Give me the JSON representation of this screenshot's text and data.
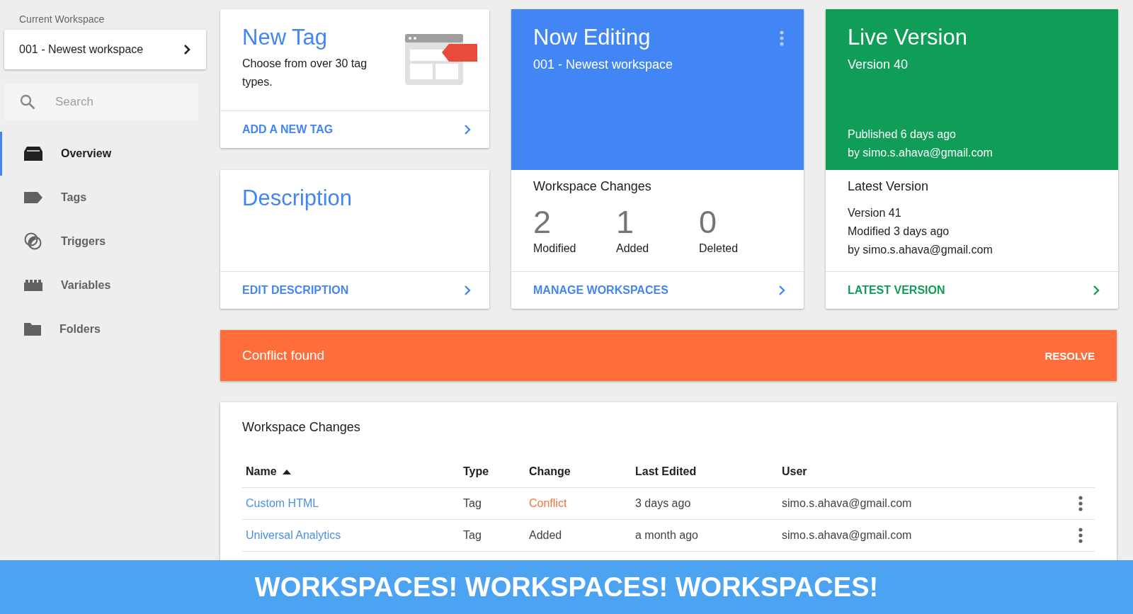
{
  "sidebar": {
    "workspace_label": "Current Workspace",
    "workspace": "001 - Newest workspace",
    "search": {
      "placeholder": "Search"
    },
    "items": [
      {
        "label": "Overview",
        "kind": "overview",
        "selected": true
      },
      {
        "label": "Tags",
        "kind": "tag",
        "selected": false
      },
      {
        "label": "Triggers",
        "kind": "trigger",
        "selected": false
      },
      {
        "label": "Variables",
        "kind": "variable",
        "selected": false
      },
      {
        "label": "Folders",
        "kind": "folder",
        "selected": false
      }
    ]
  },
  "new_tag": {
    "title": "New Tag",
    "text": "Choose from over 30 tag types.",
    "action": "ADD A NEW TAG"
  },
  "description": {
    "title": "Description",
    "action": "EDIT DESCRIPTION"
  },
  "now_editing": {
    "title": "Now Editing",
    "workspace": "001 - Newest workspace",
    "changes_title": "Workspace Changes",
    "stats": [
      {
        "value": "2",
        "label": "Modified"
      },
      {
        "value": "1",
        "label": "Added"
      },
      {
        "value": "0",
        "label": "Deleted"
      }
    ],
    "action": "MANAGE WORKSPACES"
  },
  "live_version": {
    "title": "Live Version",
    "version": "Version 40",
    "published": "Published 6 days ago",
    "published_by": "by simo.s.ahava@gmail.com",
    "latest_title": "Latest Version",
    "latest_lines": [
      "Version 41",
      "Modified 3 days ago",
      "by simo.s.ahava@gmail.com"
    ],
    "action": "LATEST VERSION"
  },
  "conflict": {
    "message": "Conflict found",
    "action": "RESOLVE"
  },
  "changes_table": {
    "title": "Workspace Changes",
    "columns": [
      "Name",
      "Type",
      "Change",
      "Last Edited",
      "User"
    ],
    "rows": [
      {
        "name": "Custom HTML",
        "type": "Tag",
        "change": "Conflict",
        "conflict": true,
        "last_edited": "3 days ago",
        "user": "simo.s.ahava@gmail.com"
      },
      {
        "name": "Universal Analytics",
        "type": "Tag",
        "change": "Added",
        "conflict": false,
        "last_edited": "a month ago",
        "user": "simo.s.ahava@gmail.com"
      }
    ]
  },
  "banner": "WORKSPACES! WORKSPACES! WORKSPACES!"
}
